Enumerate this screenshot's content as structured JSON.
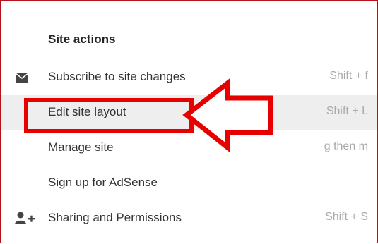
{
  "menu": {
    "title": "Site actions",
    "items": [
      {
        "label": "Subscribe to site changes",
        "shortcut": "Shift + f",
        "icon": "envelope-icon"
      },
      {
        "label": "Edit site layout",
        "shortcut": "Shift + L",
        "icon": ""
      },
      {
        "label": "Manage site",
        "shortcut": "g then m",
        "icon": ""
      },
      {
        "label": "Sign up for AdSense",
        "shortcut": "",
        "icon": ""
      },
      {
        "label": "Sharing and Permissions",
        "shortcut": "Shift + S",
        "icon": "add-person-icon"
      }
    ]
  },
  "annotation": {
    "highlight_color": "#e60000",
    "target": "Edit site layout"
  },
  "colors": {
    "frame_border": "#b5121b",
    "hover_background": "#eeeeee",
    "shortcut_text": "#aaaaaa"
  }
}
